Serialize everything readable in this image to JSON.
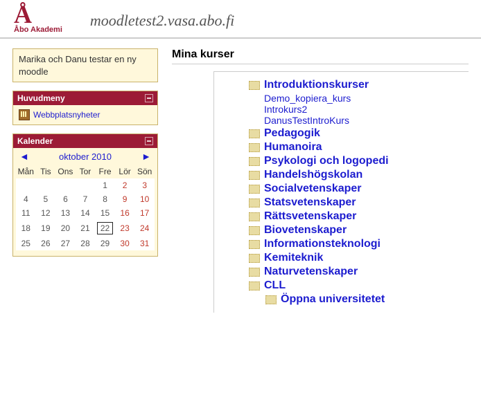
{
  "header": {
    "logo_letter": "Å",
    "logo_text": "Åbo Akademi",
    "site_title": "moodletest2.vasa.abo.fi"
  },
  "notice_block": {
    "text": "Marika och Danu testar en ny moodle"
  },
  "mainmenu": {
    "title": "Huvudmeny",
    "item": "Webbplatsnyheter"
  },
  "calendar": {
    "title": "Kalender",
    "month": "oktober 2010",
    "weekdays": [
      "Mån",
      "Tis",
      "Ons",
      "Tor",
      "Fre",
      "Lör",
      "Sön"
    ],
    "grid": [
      [
        "",
        "",
        "",
        "",
        "1",
        "2",
        "3"
      ],
      [
        "4",
        "5",
        "6",
        "7",
        "8",
        "9",
        "10"
      ],
      [
        "11",
        "12",
        "13",
        "14",
        "15",
        "16",
        "17"
      ],
      [
        "18",
        "19",
        "20",
        "21",
        "22",
        "23",
        "24"
      ],
      [
        "25",
        "26",
        "27",
        "28",
        "29",
        "30",
        "31"
      ]
    ],
    "today": "22"
  },
  "main": {
    "heading": "Mina kurser",
    "categories": [
      {
        "label": "Introduktionskurser",
        "courses": [
          "Demo_kopiera_kurs",
          "Introkurs2",
          "DanusTestIntroKurs"
        ],
        "sub": []
      },
      {
        "label": "Pedagogik",
        "courses": [],
        "sub": []
      },
      {
        "label": "Humanoira",
        "courses": [],
        "sub": []
      },
      {
        "label": "Psykologi och logopedi",
        "courses": [],
        "sub": []
      },
      {
        "label": "Handelshögskolan",
        "courses": [],
        "sub": []
      },
      {
        "label": "Socialvetenskaper",
        "courses": [],
        "sub": []
      },
      {
        "label": "Statsvetenskaper",
        "courses": [],
        "sub": []
      },
      {
        "label": "Rättsvetenskaper",
        "courses": [],
        "sub": []
      },
      {
        "label": "Biovetenskaper",
        "courses": [],
        "sub": []
      },
      {
        "label": "Informationsteknologi",
        "courses": [],
        "sub": []
      },
      {
        "label": "Kemiteknik",
        "courses": [],
        "sub": []
      },
      {
        "label": "Naturvetenskaper",
        "courses": [],
        "sub": []
      },
      {
        "label": "CLL",
        "courses": [],
        "sub": [
          {
            "label": "Öppna universitetet"
          }
        ]
      }
    ]
  }
}
